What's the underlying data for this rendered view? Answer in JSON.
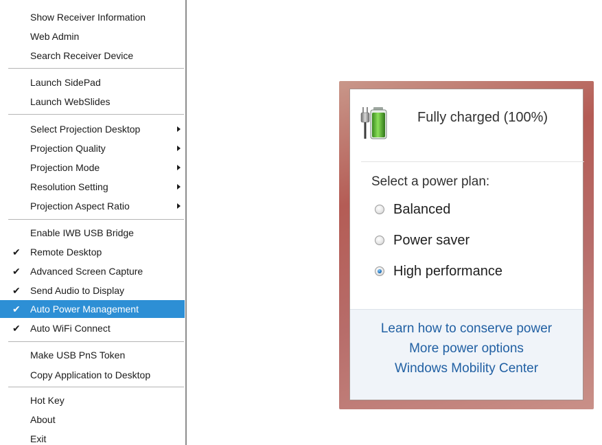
{
  "menu": {
    "items": [
      {
        "label": "Show Receiver Information",
        "checked": false,
        "submenu": false,
        "highlighted": false
      },
      {
        "label": "Web Admin",
        "checked": false,
        "submenu": false,
        "highlighted": false
      },
      {
        "label": "Search Receiver Device",
        "checked": false,
        "submenu": false,
        "highlighted": false
      },
      {
        "label": "Launch SidePad",
        "checked": false,
        "submenu": false,
        "highlighted": false
      },
      {
        "label": "Launch WebSlides",
        "checked": false,
        "submenu": false,
        "highlighted": false
      },
      {
        "label": "Select Projection Desktop",
        "checked": false,
        "submenu": true,
        "highlighted": false
      },
      {
        "label": "Projection Quality",
        "checked": false,
        "submenu": true,
        "highlighted": false
      },
      {
        "label": "Projection Mode",
        "checked": false,
        "submenu": true,
        "highlighted": false
      },
      {
        "label": "Resolution Setting",
        "checked": false,
        "submenu": true,
        "highlighted": false
      },
      {
        "label": "Projection Aspect Ratio",
        "checked": false,
        "submenu": true,
        "highlighted": false
      },
      {
        "label": "Enable IWB USB Bridge",
        "checked": false,
        "submenu": false,
        "highlighted": false
      },
      {
        "label": "Remote Desktop",
        "checked": true,
        "submenu": false,
        "highlighted": false
      },
      {
        "label": "Advanced Screen Capture",
        "checked": true,
        "submenu": false,
        "highlighted": false
      },
      {
        "label": "Send Audio to Display",
        "checked": true,
        "submenu": false,
        "highlighted": false
      },
      {
        "label": "Auto Power Management",
        "checked": true,
        "submenu": false,
        "highlighted": true
      },
      {
        "label": "Auto WiFi Connect",
        "checked": true,
        "submenu": false,
        "highlighted": false
      },
      {
        "label": "Make USB PnS Token",
        "checked": false,
        "submenu": false,
        "highlighted": false
      },
      {
        "label": "Copy Application to Desktop",
        "checked": false,
        "submenu": false,
        "highlighted": false
      },
      {
        "label": "Hot Key",
        "checked": false,
        "submenu": false,
        "highlighted": false
      },
      {
        "label": "About",
        "checked": false,
        "submenu": false,
        "highlighted": false
      },
      {
        "label": "Exit",
        "checked": false,
        "submenu": false,
        "highlighted": false
      }
    ],
    "check_glyph": "✔",
    "highlight_color": "#2d8fd5"
  },
  "power": {
    "status": "Fully charged (100%)",
    "battery_level": 1.0,
    "battery_icon": "battery-plug-icon",
    "plan_title": "Select a power plan:",
    "plans": [
      {
        "label": "Balanced",
        "selected": false
      },
      {
        "label": "Power saver",
        "selected": false
      },
      {
        "label": "High performance",
        "selected": true
      }
    ],
    "links": [
      "Learn how to conserve power",
      "More power options",
      "Windows Mobility Center"
    ],
    "link_color": "#2160a3"
  }
}
